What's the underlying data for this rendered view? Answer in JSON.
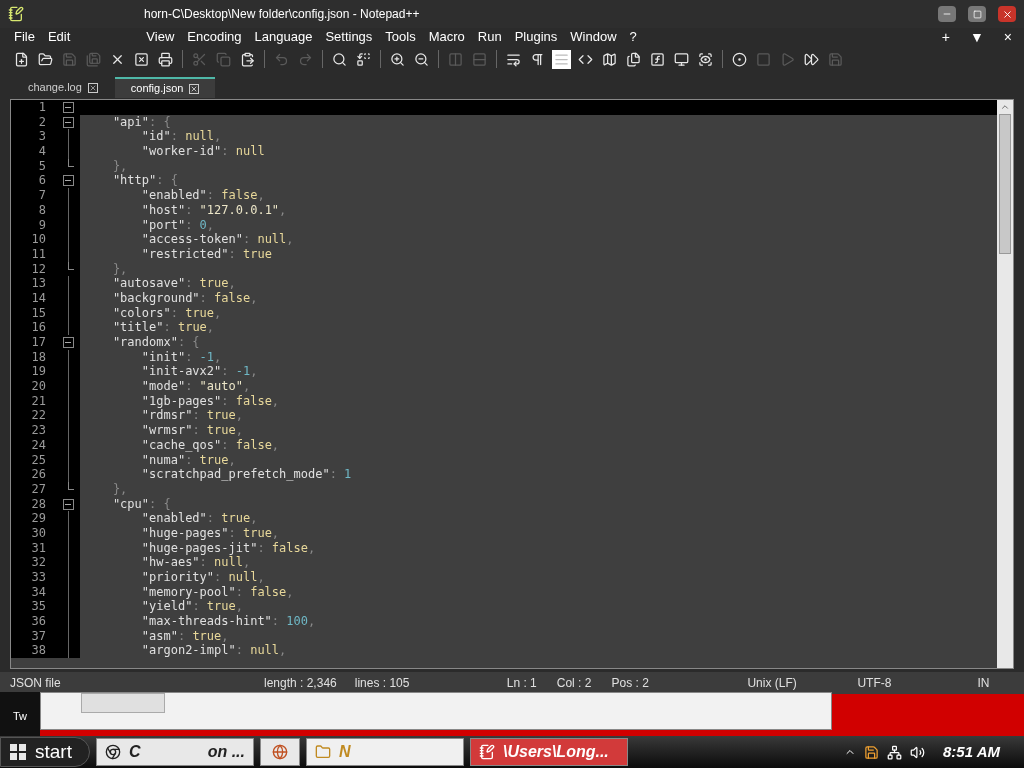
{
  "window": {
    "title": "horn-C\\Desktop\\New folder\\config.json - Notepad++"
  },
  "menu": [
    "File",
    "Edit",
    "View",
    "Encoding",
    "Language",
    "Settings",
    "Tools",
    "Macro",
    "Run",
    "Plugins",
    "Window",
    "?"
  ],
  "menu_controls": [
    "+",
    "▼",
    "×"
  ],
  "toolbar": [
    {
      "kind": "new",
      "disabled": false,
      "on": false
    },
    {
      "kind": "open",
      "disabled": false,
      "on": false
    },
    {
      "kind": "save",
      "disabled": true,
      "on": false
    },
    {
      "kind": "saveall",
      "disabled": true,
      "on": false
    },
    {
      "kind": "close",
      "disabled": false,
      "on": false
    },
    {
      "kind": "closeall",
      "disabled": false,
      "on": false
    },
    {
      "kind": "print",
      "disabled": false,
      "on": false
    },
    {
      "kind": "sep"
    },
    {
      "kind": "cut",
      "disabled": true,
      "on": false
    },
    {
      "kind": "copy",
      "disabled": true,
      "on": false
    },
    {
      "kind": "paste",
      "disabled": false,
      "on": false
    },
    {
      "kind": "sep"
    },
    {
      "kind": "undo",
      "disabled": true,
      "on": false
    },
    {
      "kind": "redo",
      "disabled": true,
      "on": false
    },
    {
      "kind": "sep"
    },
    {
      "kind": "find",
      "disabled": false,
      "on": false
    },
    {
      "kind": "replace",
      "disabled": false,
      "on": false
    },
    {
      "kind": "sep"
    },
    {
      "kind": "zoomin",
      "disabled": false,
      "on": false
    },
    {
      "kind": "zoomout",
      "disabled": false,
      "on": false
    },
    {
      "kind": "sep"
    },
    {
      "kind": "syncv",
      "disabled": true,
      "on": false
    },
    {
      "kind": "synch",
      "disabled": true,
      "on": false
    },
    {
      "kind": "sep"
    },
    {
      "kind": "wrap",
      "disabled": false,
      "on": false
    },
    {
      "kind": "allchars",
      "disabled": false,
      "on": false
    },
    {
      "kind": "indentguide",
      "disabled": false,
      "on": true
    },
    {
      "kind": "xml",
      "disabled": false,
      "on": false
    },
    {
      "kind": "docmap",
      "disabled": false,
      "on": false
    },
    {
      "kind": "doclist",
      "disabled": false,
      "on": false
    },
    {
      "kind": "function",
      "disabled": false,
      "on": false
    },
    {
      "kind": "monitor",
      "disabled": false,
      "on": false
    },
    {
      "kind": "monitoring",
      "disabled": false,
      "on": false
    },
    {
      "kind": "sep"
    },
    {
      "kind": "record",
      "disabled": false,
      "on": false
    },
    {
      "kind": "stop",
      "disabled": true,
      "on": false
    },
    {
      "kind": "play",
      "disabled": true,
      "on": false
    },
    {
      "kind": "playmulti",
      "disabled": false,
      "on": false
    },
    {
      "kind": "savemacro",
      "disabled": true,
      "on": false
    }
  ],
  "tabs": [
    {
      "label": "change.log",
      "selected": false
    },
    {
      "label": "config.json",
      "selected": true
    }
  ],
  "editor": {
    "lines": [
      {
        "num": "1",
        "kind": "opener",
        "current": true
      },
      {
        "num": "2",
        "kind": "opener",
        "current": false,
        "tokens": [
          {
            "kind": "key",
            "text": "    \"api\""
          },
          {
            "kind": "punct",
            "text": ": {"
          }
        ]
      },
      {
        "num": "3",
        "kind": "plain",
        "current": false,
        "tokens": [
          {
            "kind": "key",
            "text": "        \"id\""
          },
          {
            "kind": "punct",
            "text": ": "
          },
          {
            "kind": "word",
            "text": "null"
          },
          {
            "kind": "punct",
            "text": ","
          }
        ]
      },
      {
        "num": "4",
        "kind": "plain",
        "current": false,
        "tokens": [
          {
            "kind": "key",
            "text": "        \"worker-id\""
          },
          {
            "kind": "punct",
            "text": ": "
          },
          {
            "kind": "word",
            "text": "null"
          }
        ]
      },
      {
        "num": "5",
        "kind": "closer",
        "current": false,
        "tokens": [
          {
            "kind": "punct",
            "text": "    },"
          }
        ]
      },
      {
        "num": "6",
        "kind": "opener",
        "current": false,
        "tokens": [
          {
            "kind": "key",
            "text": "    \"http\""
          },
          {
            "kind": "punct",
            "text": ": {"
          }
        ]
      },
      {
        "num": "7",
        "kind": "plain",
        "current": false,
        "tokens": [
          {
            "kind": "key",
            "text": "        \"enabled\""
          },
          {
            "kind": "punct",
            "text": ": "
          },
          {
            "kind": "word",
            "text": "false"
          },
          {
            "kind": "punct",
            "text": ","
          }
        ]
      },
      {
        "num": "8",
        "kind": "plain",
        "current": false,
        "tokens": [
          {
            "kind": "key",
            "text": "        \"host\""
          },
          {
            "kind": "punct",
            "text": ": "
          },
          {
            "kind": "string",
            "text": "\"127.0.0.1\""
          },
          {
            "kind": "punct",
            "text": ","
          }
        ]
      },
      {
        "num": "9",
        "kind": "plain",
        "current": false,
        "tokens": [
          {
            "kind": "key",
            "text": "        \"port\""
          },
          {
            "kind": "punct",
            "text": ": "
          },
          {
            "kind": "number",
            "text": "0"
          },
          {
            "kind": "punct",
            "text": ","
          }
        ]
      },
      {
        "num": "10",
        "kind": "plain",
        "current": false,
        "tokens": [
          {
            "kind": "key",
            "text": "        \"access-token\""
          },
          {
            "kind": "punct",
            "text": ": "
          },
          {
            "kind": "word",
            "text": "null"
          },
          {
            "kind": "punct",
            "text": ","
          }
        ]
      },
      {
        "num": "11",
        "kind": "plain",
        "current": false,
        "tokens": [
          {
            "kind": "key",
            "text": "        \"restricted\""
          },
          {
            "kind": "punct",
            "text": ": "
          },
          {
            "kind": "word",
            "text": "true"
          }
        ]
      },
      {
        "num": "12",
        "kind": "closer",
        "current": false,
        "tokens": [
          {
            "kind": "punct",
            "text": "    },"
          }
        ]
      },
      {
        "num": "13",
        "kind": "plain",
        "current": false,
        "tokens": [
          {
            "kind": "key",
            "text": "    \"autosave\""
          },
          {
            "kind": "punct",
            "text": ": "
          },
          {
            "kind": "word",
            "text": "true"
          },
          {
            "kind": "punct",
            "text": ","
          }
        ]
      },
      {
        "num": "14",
        "kind": "plain",
        "current": false,
        "tokens": [
          {
            "kind": "key",
            "text": "    \"background\""
          },
          {
            "kind": "punct",
            "text": ": "
          },
          {
            "kind": "word",
            "text": "false"
          },
          {
            "kind": "punct",
            "text": ","
          }
        ]
      },
      {
        "num": "15",
        "kind": "plain",
        "current": false,
        "tokens": [
          {
            "kind": "key",
            "text": "    \"colors\""
          },
          {
            "kind": "punct",
            "text": ": "
          },
          {
            "kind": "word",
            "text": "true"
          },
          {
            "kind": "punct",
            "text": ","
          }
        ]
      },
      {
        "num": "16",
        "kind": "plain",
        "current": false,
        "tokens": [
          {
            "kind": "key",
            "text": "    \"title\""
          },
          {
            "kind": "punct",
            "text": ": "
          },
          {
            "kind": "word",
            "text": "true"
          },
          {
            "kind": "punct",
            "text": ","
          }
        ]
      },
      {
        "num": "17",
        "kind": "opener",
        "current": false,
        "tokens": [
          {
            "kind": "key",
            "text": "    \"randomx\""
          },
          {
            "kind": "punct",
            "text": ": {"
          }
        ]
      },
      {
        "num": "18",
        "kind": "plain",
        "current": false,
        "tokens": [
          {
            "kind": "key",
            "text": "        \"init\""
          },
          {
            "kind": "punct",
            "text": ": "
          },
          {
            "kind": "number",
            "text": "-1"
          },
          {
            "kind": "punct",
            "text": ","
          }
        ]
      },
      {
        "num": "19",
        "kind": "plain",
        "current": false,
        "tokens": [
          {
            "kind": "key",
            "text": "        \"init-avx2\""
          },
          {
            "kind": "punct",
            "text": ": "
          },
          {
            "kind": "number",
            "text": "-1"
          },
          {
            "kind": "punct",
            "text": ","
          }
        ]
      },
      {
        "num": "20",
        "kind": "plain",
        "current": false,
        "tokens": [
          {
            "kind": "key",
            "text": "        \"mode\""
          },
          {
            "kind": "punct",
            "text": ": "
          },
          {
            "kind": "string",
            "text": "\"auto\""
          },
          {
            "kind": "punct",
            "text": ","
          }
        ]
      },
      {
        "num": "21",
        "kind": "plain",
        "current": false,
        "tokens": [
          {
            "kind": "key",
            "text": "        \"1gb-pages\""
          },
          {
            "kind": "punct",
            "text": ": "
          },
          {
            "kind": "word",
            "text": "false"
          },
          {
            "kind": "punct",
            "text": ","
          }
        ]
      },
      {
        "num": "22",
        "kind": "plain",
        "current": false,
        "tokens": [
          {
            "kind": "key",
            "text": "        \"rdmsr\""
          },
          {
            "kind": "punct",
            "text": ": "
          },
          {
            "kind": "word",
            "text": "true"
          },
          {
            "kind": "punct",
            "text": ","
          }
        ]
      },
      {
        "num": "23",
        "kind": "plain",
        "current": false,
        "tokens": [
          {
            "kind": "key",
            "text": "        \"wrmsr\""
          },
          {
            "kind": "punct",
            "text": ": "
          },
          {
            "kind": "word",
            "text": "true"
          },
          {
            "kind": "punct",
            "text": ","
          }
        ]
      },
      {
        "num": "24",
        "kind": "plain",
        "current": false,
        "tokens": [
          {
            "kind": "key",
            "text": "        \"cache_qos\""
          },
          {
            "kind": "punct",
            "text": ": "
          },
          {
            "kind": "word",
            "text": "false"
          },
          {
            "kind": "punct",
            "text": ","
          }
        ]
      },
      {
        "num": "25",
        "kind": "plain",
        "current": false,
        "tokens": [
          {
            "kind": "key",
            "text": "        \"numa\""
          },
          {
            "kind": "punct",
            "text": ": "
          },
          {
            "kind": "word",
            "text": "true"
          },
          {
            "kind": "punct",
            "text": ","
          }
        ]
      },
      {
        "num": "26",
        "kind": "plain",
        "current": false,
        "tokens": [
          {
            "kind": "key",
            "text": "        \"scratchpad_prefetch_mode\""
          },
          {
            "kind": "punct",
            "text": ": "
          },
          {
            "kind": "number",
            "text": "1"
          }
        ]
      },
      {
        "num": "27",
        "kind": "closer",
        "current": false,
        "tokens": [
          {
            "kind": "punct",
            "text": "    },"
          }
        ]
      },
      {
        "num": "28",
        "kind": "opener",
        "current": false,
        "tokens": [
          {
            "kind": "key",
            "text": "    \"cpu\""
          },
          {
            "kind": "punct",
            "text": ": {"
          }
        ]
      },
      {
        "num": "29",
        "kind": "plain",
        "current": false,
        "tokens": [
          {
            "kind": "key",
            "text": "        \"enabled\""
          },
          {
            "kind": "punct",
            "text": ": "
          },
          {
            "kind": "word",
            "text": "true"
          },
          {
            "kind": "punct",
            "text": ","
          }
        ]
      },
      {
        "num": "30",
        "kind": "plain",
        "current": false,
        "tokens": [
          {
            "kind": "key",
            "text": "        \"huge-pages\""
          },
          {
            "kind": "punct",
            "text": ": "
          },
          {
            "kind": "word",
            "text": "true"
          },
          {
            "kind": "punct",
            "text": ","
          }
        ]
      },
      {
        "num": "31",
        "kind": "plain",
        "current": false,
        "tokens": [
          {
            "kind": "key",
            "text": "        \"huge-pages-jit\""
          },
          {
            "kind": "punct",
            "text": ": "
          },
          {
            "kind": "word",
            "text": "false"
          },
          {
            "kind": "punct",
            "text": ","
          }
        ]
      },
      {
        "num": "32",
        "kind": "plain",
        "current": false,
        "tokens": [
          {
            "kind": "key",
            "text": "        \"hw-aes\""
          },
          {
            "kind": "punct",
            "text": ": "
          },
          {
            "kind": "word",
            "text": "null"
          },
          {
            "kind": "punct",
            "text": ","
          }
        ]
      },
      {
        "num": "33",
        "kind": "plain",
        "current": false,
        "tokens": [
          {
            "kind": "key",
            "text": "        \"priority\""
          },
          {
            "kind": "punct",
            "text": ": "
          },
          {
            "kind": "word",
            "text": "null"
          },
          {
            "kind": "punct",
            "text": ","
          }
        ]
      },
      {
        "num": "34",
        "kind": "plain",
        "current": false,
        "tokens": [
          {
            "kind": "key",
            "text": "        \"memory-pool\""
          },
          {
            "kind": "punct",
            "text": ": "
          },
          {
            "kind": "word",
            "text": "false"
          },
          {
            "kind": "punct",
            "text": ","
          }
        ]
      },
      {
        "num": "35",
        "kind": "plain",
        "current": false,
        "tokens": [
          {
            "kind": "key",
            "text": "        \"yield\""
          },
          {
            "kind": "punct",
            "text": ": "
          },
          {
            "kind": "word",
            "text": "true"
          },
          {
            "kind": "punct",
            "text": ","
          }
        ]
      },
      {
        "num": "36",
        "kind": "plain",
        "current": false,
        "tokens": [
          {
            "kind": "key",
            "text": "        \"max-threads-hint\""
          },
          {
            "kind": "punct",
            "text": ": "
          },
          {
            "kind": "number",
            "text": "100"
          },
          {
            "kind": "punct",
            "text": ","
          }
        ]
      },
      {
        "num": "37",
        "kind": "plain",
        "current": false,
        "tokens": [
          {
            "kind": "key",
            "text": "        \"asm\""
          },
          {
            "kind": "punct",
            "text": ": "
          },
          {
            "kind": "word",
            "text": "true"
          },
          {
            "kind": "punct",
            "text": ","
          }
        ]
      },
      {
        "num": "38",
        "kind": "plain",
        "current": false,
        "tokens": [
          {
            "kind": "key",
            "text": "        \"argon2-impl\""
          },
          {
            "kind": "punct",
            "text": ": "
          },
          {
            "kind": "word",
            "text": "null"
          },
          {
            "kind": "punct",
            "text": ","
          }
        ]
      }
    ]
  },
  "status_bar": {
    "file_type": "JSON file",
    "length": "length : 2,346",
    "lines": "lines : 105",
    "ln": "Ln : 1",
    "col": "Col : 2",
    "pos": "Pos : 2",
    "eol": "Unix (LF)",
    "encoding": "UTF-8",
    "mode": "IN"
  },
  "desktop": {
    "icon_label": "Tw"
  },
  "taskbar": {
    "start": "start",
    "items": [
      {
        "kind": "chrome",
        "label": "C",
        "label_2": "on ..."
      },
      {
        "kind": "firefox"
      },
      {
        "kind": "folder",
        "label": "N"
      },
      {
        "kind": "notepad",
        "label": "\\Users\\Long..."
      }
    ],
    "clock": "8:51 AM"
  }
}
